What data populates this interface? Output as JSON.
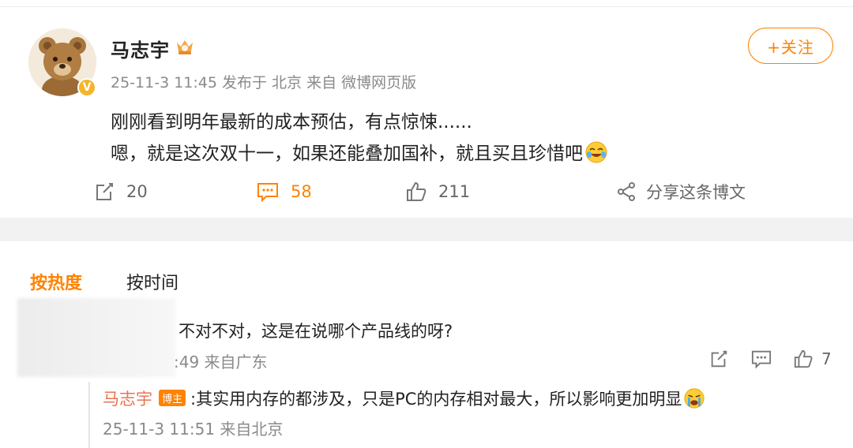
{
  "post": {
    "author": "马志宇",
    "meta": "25-11-3 11:45 发布于 北京 来自 微博网页版",
    "follow_label": "+关注",
    "verified_mark": "V",
    "lines": [
      "刚刚看到明年最新的成本预估，有点惊悚......",
      "嗯，就是这次双十一，如果还能叠加国补，就且买且珍惜吧"
    ],
    "actions": {
      "repost": "20",
      "comment": "58",
      "like": "211",
      "share": "分享这条博文"
    }
  },
  "comments": {
    "sort_hot": "按热度",
    "sort_time": "按时间",
    "first": {
      "text": "不对不对，这是在说哪个产品线的呀?",
      "meta": ":49 来自广东",
      "likes": "7"
    },
    "reply": {
      "name": "马志宇",
      "badge": "博主",
      "text": ":其实用内存的都涉及，只是PC的内存相对最大，所以影响更加明显",
      "meta": "25-11-3 11:51 来自北京"
    }
  },
  "colors": {
    "accent": "#ff8200",
    "name_link": "#eb7350",
    "muted": "#8a8a8a"
  }
}
